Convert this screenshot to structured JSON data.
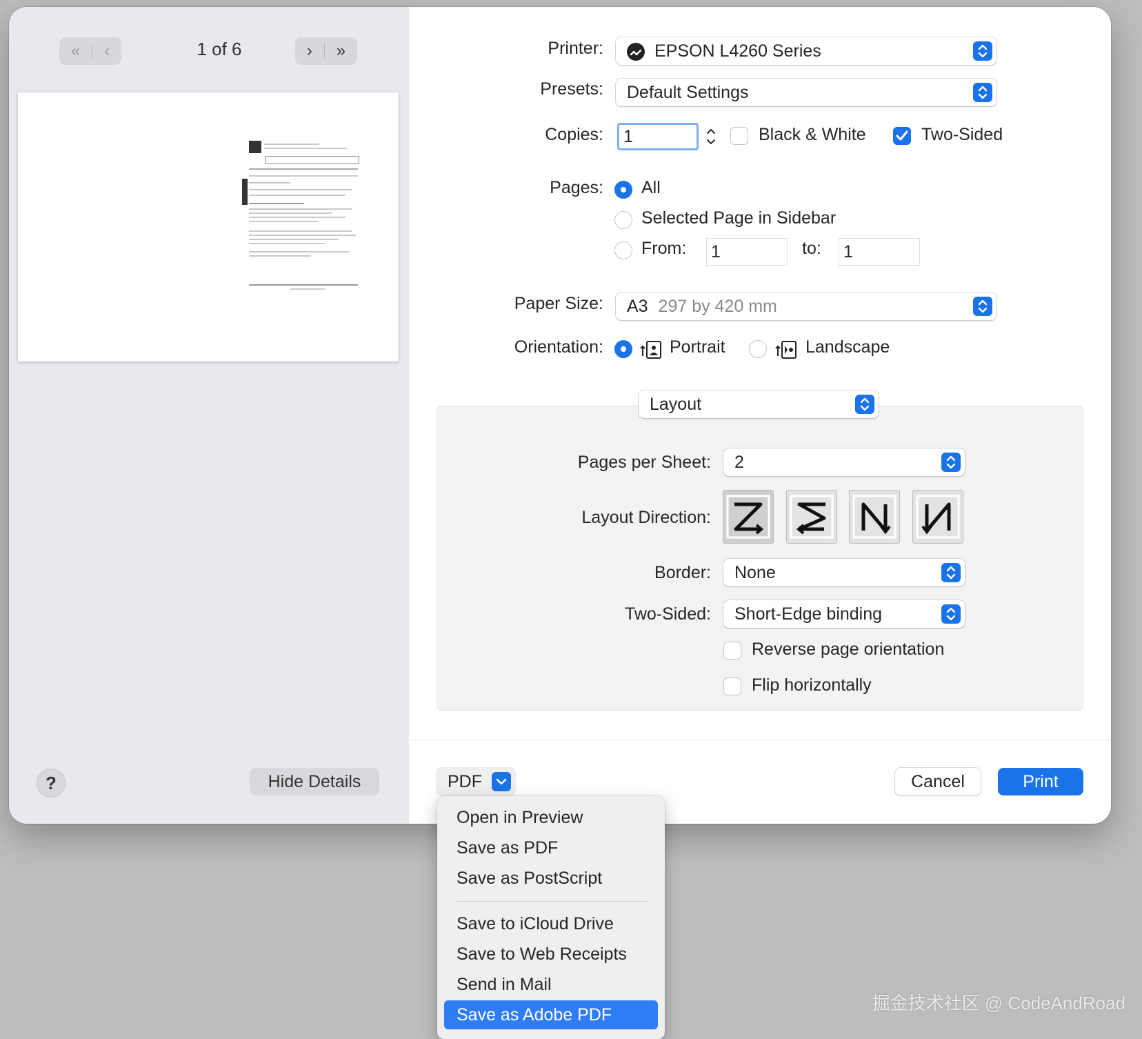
{
  "sidebar": {
    "page_indicator": "1 of 6",
    "help_label": "?",
    "hide_details_label": "Hide Details"
  },
  "printer": {
    "label": "Printer:",
    "value": "EPSON L4260 Series"
  },
  "presets": {
    "label": "Presets:",
    "value": "Default Settings"
  },
  "copies": {
    "label": "Copies:",
    "value": "1",
    "black_white_label": "Black & White",
    "two_sided_label": "Two-Sided",
    "black_white_checked": false,
    "two_sided_checked": true
  },
  "pages": {
    "label": "Pages:",
    "all_label": "All",
    "selected_label": "Selected Page in Sidebar",
    "from_label": "From:",
    "from_value": "1",
    "to_label": "to:",
    "to_value": "1"
  },
  "paper_size": {
    "label": "Paper Size:",
    "name": "A3",
    "dims": "297 by 420 mm"
  },
  "orientation": {
    "label": "Orientation:",
    "portrait_label": "Portrait",
    "landscape_label": "Landscape"
  },
  "section_popup": "Layout",
  "layout": {
    "pages_per_sheet_label": "Pages per Sheet:",
    "pages_per_sheet_value": "2",
    "layout_direction_label": "Layout Direction:",
    "border_label": "Border:",
    "border_value": "None",
    "two_sided_label": "Two-Sided:",
    "two_sided_value": "Short-Edge binding",
    "reverse_label": "Reverse page orientation",
    "flip_label": "Flip horizontally"
  },
  "footer": {
    "pdf_label": "PDF",
    "cancel_label": "Cancel",
    "print_label": "Print"
  },
  "pdf_menu": {
    "group1": [
      "Open in Preview",
      "Save as PDF",
      "Save as PostScript"
    ],
    "group2": [
      "Save to iCloud Drive",
      "Save to Web Receipts",
      "Send in Mail",
      "Save as Adobe PDF"
    ],
    "highlighted": "Save as Adobe PDF"
  },
  "watermark": "掘金技术社区 @ CodeAndRoad",
  "colors": {
    "accent": "#1a73e8",
    "menu_highlight": "#2f7df6"
  }
}
